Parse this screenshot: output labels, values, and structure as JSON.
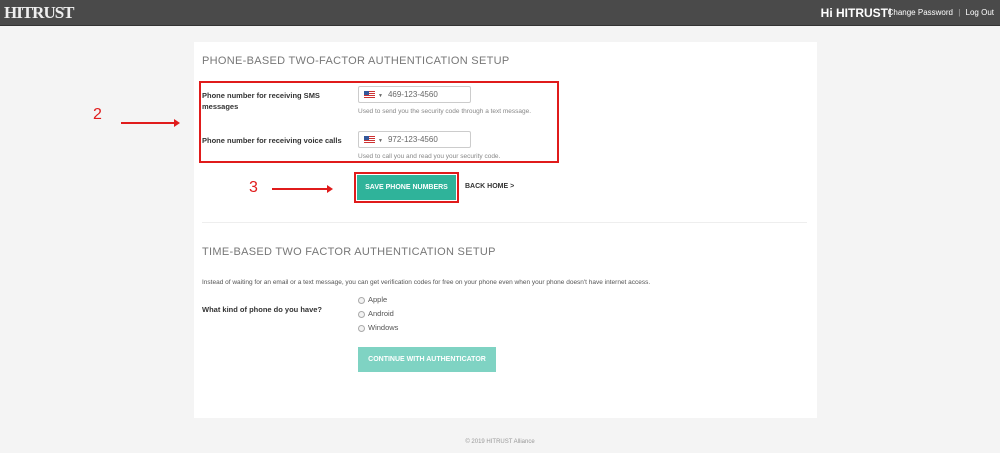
{
  "header": {
    "logo": "HITRUST",
    "greeting": "Hi HITRUST!",
    "change_password": "Change Password",
    "separator": "|",
    "logout": "Log Out"
  },
  "phone_section": {
    "title": "PHONE-BASED TWO-FACTOR AUTHENTICATION SETUP",
    "sms_label": "Phone number for receiving SMS messages",
    "sms_value": "469-123-4560",
    "sms_help": "Used to send you the security code through a text message.",
    "voice_label": "Phone number for receiving voice calls",
    "voice_value": "972-123-4560",
    "voice_help": "Used to call you and read you your security code.",
    "save_button": "SAVE PHONE NUMBERS",
    "back_home": "BACK HOME >"
  },
  "annotations": {
    "step2": "2",
    "step3": "3",
    "color": "#e01b1b"
  },
  "time_section": {
    "title": "TIME-BASED TWO FACTOR AUTHENTICATION SETUP",
    "description": "Instead of waiting for an email or a text message, you can get verification codes for free on your phone even when your phone doesn't have internet access.",
    "question": "What kind of phone do you have?",
    "options": [
      "Apple",
      "Android",
      "Windows"
    ],
    "continue_button": "CONTINUE WITH AUTHENTICATOR"
  },
  "footer": "© 2019 HITRUST Alliance",
  "colors": {
    "accent": "#2fb39a",
    "accent_disabled": "#7fd3c3"
  }
}
